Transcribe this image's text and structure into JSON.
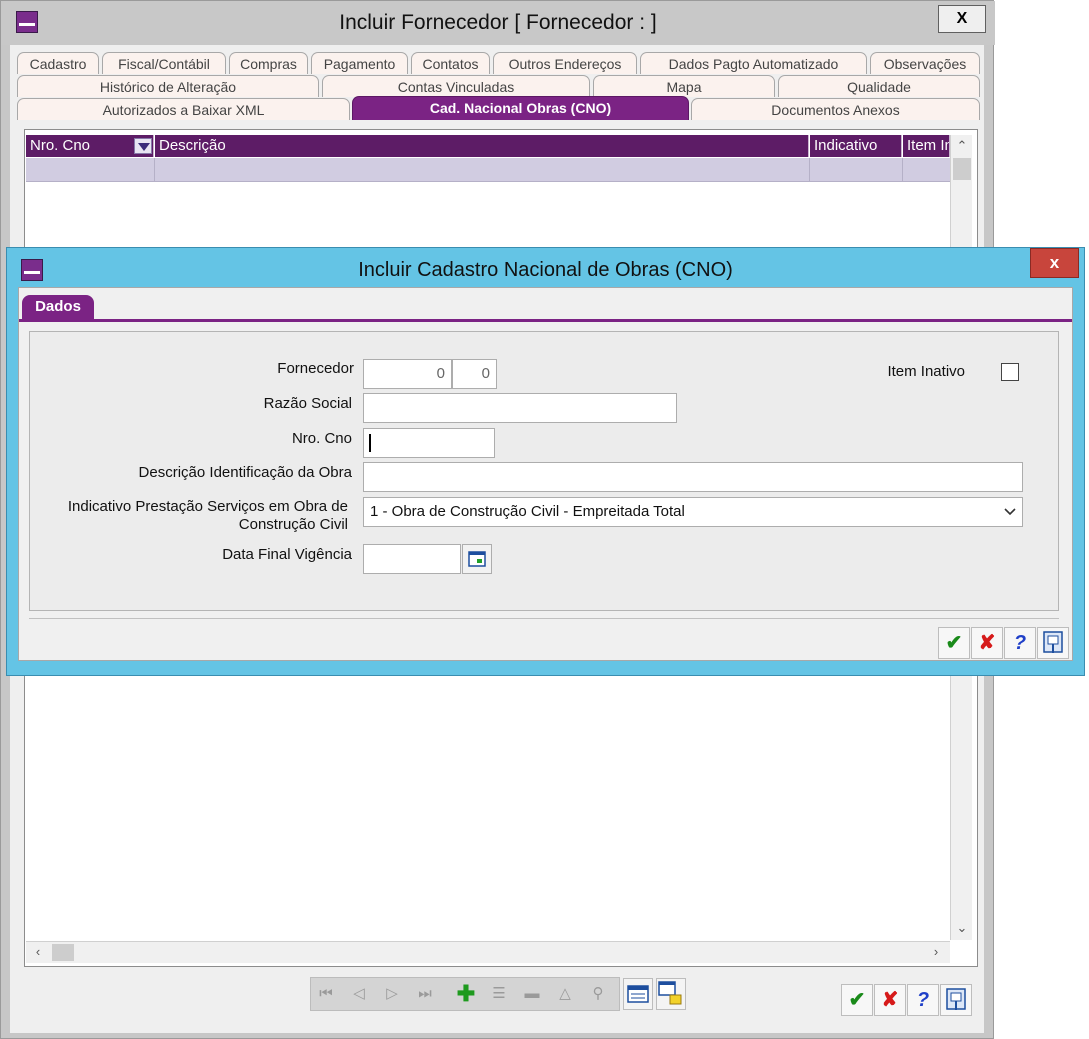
{
  "main_window": {
    "title": "Incluir Fornecedor [ Fornecedor : ]",
    "close_label": "X",
    "tabs_row1": [
      "Cadastro",
      "Fiscal/Contábil",
      "Compras",
      "Pagamento",
      "Contatos",
      "Outros Endereços",
      "Dados Pagto Automatizado",
      "Observações"
    ],
    "tabs_row2": [
      "Histórico de Alteração",
      "Contas Vinculadas",
      "Mapa",
      "Qualidade"
    ],
    "tabs_row3": [
      "Autorizados a Baixar XML",
      "Cad. Nacional Obras (CNO)",
      "Documentos Anexos"
    ],
    "active_tab": "Cad. Nacional Obras (CNO)",
    "grid": {
      "columns": [
        "Nro. Cno",
        "Descrição",
        "Indicativo",
        "Item In"
      ]
    }
  },
  "dialog": {
    "title": "Incluir Cadastro Nacional de Obras (CNO)",
    "close_label": "x",
    "tab": "Dados",
    "fields": {
      "fornecedor_label": "Fornecedor",
      "fornecedor_value1": "0",
      "fornecedor_value2": "0",
      "item_inativo_label": "Item Inativo",
      "razao_social_label": "Razão Social",
      "razao_social_value": "",
      "nro_cno_label": "Nro. Cno",
      "nro_cno_value": "",
      "descricao_label": "Descrição Identificação da Obra",
      "descricao_value": "",
      "indicativo_label_line1": "Indicativo Prestação Serviços em Obra de",
      "indicativo_label_line2": "Construção Civil",
      "indicativo_value": "1 - Obra de Construção Civil - Empreitada Total",
      "data_final_label": "Data Final Vigência",
      "data_final_value": ""
    }
  },
  "icons": {
    "confirm": "check-icon",
    "cancel": "x-icon",
    "help": "question-icon",
    "export": "export-icon"
  },
  "colors": {
    "accent": "#7b2384",
    "dialog_frame": "#64c4e5",
    "grid_header": "#5d1c66",
    "confirm": "#1a8a1a",
    "cancel": "#d61a1a",
    "help": "#1f3fc8"
  }
}
